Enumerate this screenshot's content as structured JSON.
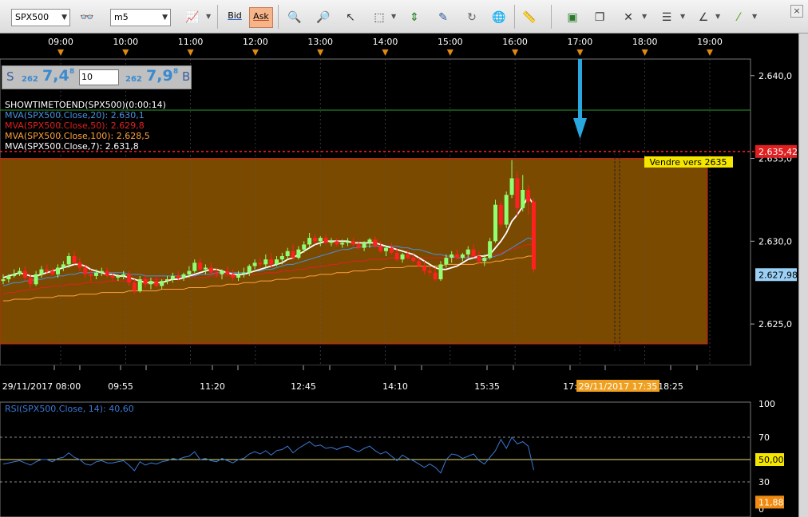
{
  "toolbar": {
    "symbol": "SPX500",
    "timeframe": "m5",
    "bid_label": "Bid",
    "ask_label": "Ask"
  },
  "quote": {
    "sell_letter": "S",
    "sell_small": "262",
    "sell_big": "7,4",
    "sell_sup": "8",
    "quantity": "10",
    "buy_small": "262",
    "buy_big": "7,9",
    "buy_sup": "8",
    "buy_letter": "B"
  },
  "indicators": [
    {
      "text": "SHOWTIMETOEND(SPX500)(0:00:14)",
      "color": "#ffffff"
    },
    {
      "text": "MVA(SPX500.Close,20): 2.630,1",
      "color": "#4a90e2"
    },
    {
      "text": "MVA(SPX500.Close,50): 2.629,8",
      "color": "#e02020"
    },
    {
      "text": "MVA(SPX500.Close,100): 2.628,5",
      "color": "#ffa040"
    },
    {
      "text": "MVA(SPX500.Close,7): 2.631,8",
      "color": "#ffffff"
    }
  ],
  "time_axis_top": [
    "09:00",
    "10:00",
    "11:00",
    "12:00",
    "13:00",
    "14:00",
    "15:00",
    "16:00",
    "17:00",
    "18:00",
    "19:00"
  ],
  "price_axis": {
    "ticks": [
      "2.640,0",
      "2.635,0",
      "2.630,0",
      "2.625,0"
    ],
    "alert_price": "2.635,42",
    "current_price": "2.627,98"
  },
  "annotation": "Vendre vers 2635",
  "time_axis_bottom": [
    "29/11/2017 08:00",
    "09:55",
    "11:20",
    "12:45",
    "14:10",
    "15:35",
    "17:",
    "18:25"
  ],
  "cursor_time": "29/11/2017 17:35",
  "rsi": {
    "label": "RSI(SPX500.Close, 14): 40,60",
    "ticks": [
      "100",
      "70",
      "50,00",
      "30",
      "0"
    ],
    "current": "11,88"
  },
  "colors": {
    "zone_fill": "#7a4a00",
    "bull_candle": "#90ff70",
    "bear_candle": "#ff2020",
    "rsi_line": "#3a7ad5",
    "alert_line": "#ff2020",
    "arrow": "#29a8e0"
  },
  "chart_data": {
    "type": "candlestick",
    "y_range": [
      2622.5,
      2641.0
    ],
    "candles": [
      [
        2627.6,
        2628.0,
        2627.4,
        2627.7
      ],
      [
        2627.7,
        2628.0,
        2627.5,
        2627.9
      ],
      [
        2627.9,
        2628.3,
        2627.8,
        2628.0
      ],
      [
        2628.0,
        2628.4,
        2627.9,
        2628.2
      ],
      [
        2628.2,
        2628.5,
        2627.6,
        2627.8
      ],
      [
        2627.8,
        2628.0,
        2627.2,
        2627.4
      ],
      [
        2627.4,
        2628.2,
        2627.3,
        2628.0
      ],
      [
        2628.0,
        2628.5,
        2627.8,
        2628.3
      ],
      [
        2628.3,
        2628.6,
        2628.0,
        2628.2
      ],
      [
        2628.2,
        2628.4,
        2627.9,
        2628.0
      ],
      [
        2628.0,
        2628.6,
        2627.8,
        2628.4
      ],
      [
        2628.4,
        2628.8,
        2628.2,
        2628.6
      ],
      [
        2628.6,
        2629.3,
        2628.4,
        2629.1
      ],
      [
        2629.1,
        2629.4,
        2628.6,
        2628.7
      ],
      [
        2628.7,
        2629.0,
        2628.2,
        2628.4
      ],
      [
        2628.4,
        2628.6,
        2627.8,
        2628.0
      ],
      [
        2628.0,
        2628.3,
        2627.6,
        2627.9
      ],
      [
        2627.9,
        2628.3,
        2627.7,
        2628.1
      ],
      [
        2628.1,
        2628.4,
        2627.9,
        2628.2
      ],
      [
        2628.2,
        2628.4,
        2627.8,
        2627.9
      ],
      [
        2627.9,
        2628.1,
        2627.6,
        2627.8
      ],
      [
        2627.8,
        2628.0,
        2627.6,
        2627.9
      ],
      [
        2627.9,
        2628.2,
        2627.7,
        2628.0
      ],
      [
        2628.0,
        2628.2,
        2627.3,
        2627.5
      ],
      [
        2627.5,
        2627.7,
        2626.8,
        2627.0
      ],
      [
        2627.0,
        2627.9,
        2626.9,
        2627.7
      ],
      [
        2627.7,
        2628.0,
        2627.2,
        2627.4
      ],
      [
        2627.4,
        2627.8,
        2627.1,
        2627.6
      ],
      [
        2627.6,
        2627.9,
        2627.2,
        2627.3
      ],
      [
        2627.3,
        2627.7,
        2627.1,
        2627.6
      ],
      [
        2627.6,
        2627.9,
        2627.4,
        2627.7
      ],
      [
        2627.7,
        2628.1,
        2627.5,
        2627.9
      ],
      [
        2627.9,
        2628.2,
        2627.6,
        2627.8
      ],
      [
        2627.8,
        2628.1,
        2627.6,
        2628.0
      ],
      [
        2628.0,
        2628.5,
        2627.8,
        2628.2
      ],
      [
        2628.2,
        2628.9,
        2628.1,
        2628.7
      ],
      [
        2628.7,
        2629.0,
        2628.2,
        2628.3
      ],
      [
        2628.3,
        2628.6,
        2628.0,
        2628.4
      ],
      [
        2628.4,
        2628.7,
        2628.0,
        2628.1
      ],
      [
        2628.1,
        2628.4,
        2627.8,
        2628.0
      ],
      [
        2628.0,
        2628.3,
        2627.7,
        2628.2
      ],
      [
        2628.2,
        2628.5,
        2627.9,
        2628.0
      ],
      [
        2628.0,
        2628.3,
        2627.6,
        2627.8
      ],
      [
        2627.8,
        2628.2,
        2627.6,
        2628.0
      ],
      [
        2628.0,
        2628.4,
        2627.8,
        2628.1
      ],
      [
        2628.1,
        2628.6,
        2627.9,
        2628.5
      ],
      [
        2628.5,
        2628.9,
        2628.3,
        2628.7
      ],
      [
        2628.7,
        2629.0,
        2628.4,
        2628.6
      ],
      [
        2628.6,
        2629.2,
        2628.4,
        2628.9
      ],
      [
        2628.9,
        2629.3,
        2628.4,
        2628.6
      ],
      [
        2628.6,
        2629.1,
        2628.5,
        2628.9
      ],
      [
        2628.9,
        2629.3,
        2628.6,
        2629.1
      ],
      [
        2629.1,
        2629.6,
        2628.9,
        2629.4
      ],
      [
        2629.4,
        2629.8,
        2628.9,
        2629.0
      ],
      [
        2629.0,
        2629.7,
        2628.9,
        2629.5
      ],
      [
        2629.5,
        2630.0,
        2629.3,
        2629.8
      ],
      [
        2629.8,
        2630.5,
        2629.6,
        2630.2
      ],
      [
        2630.2,
        2630.4,
        2629.8,
        2630.0
      ],
      [
        2630.0,
        2630.3,
        2629.7,
        2630.2
      ],
      [
        2630.2,
        2630.4,
        2629.8,
        2629.9
      ],
      [
        2629.9,
        2630.2,
        2629.7,
        2630.0
      ],
      [
        2630.0,
        2630.2,
        2629.7,
        2629.8
      ],
      [
        2629.8,
        2630.1,
        2629.6,
        2629.9
      ],
      [
        2629.9,
        2630.2,
        2629.7,
        2630.0
      ],
      [
        2630.0,
        2630.2,
        2629.7,
        2629.8
      ],
      [
        2629.8,
        2630.0,
        2629.5,
        2629.6
      ],
      [
        2629.6,
        2630.0,
        2629.4,
        2629.9
      ],
      [
        2629.9,
        2630.2,
        2629.6,
        2630.1
      ],
      [
        2630.1,
        2630.3,
        2629.6,
        2629.7
      ],
      [
        2629.7,
        2630.0,
        2629.3,
        2629.4
      ],
      [
        2629.4,
        2629.7,
        2629.1,
        2629.6
      ],
      [
        2629.6,
        2629.9,
        2629.2,
        2629.3
      ],
      [
        2629.3,
        2629.6,
        2628.8,
        2628.9
      ],
      [
        2628.9,
        2629.3,
        2628.7,
        2629.2
      ],
      [
        2629.2,
        2629.5,
        2628.9,
        2629.0
      ],
      [
        2629.0,
        2629.2,
        2628.7,
        2628.8
      ],
      [
        2628.8,
        2629.0,
        2628.4,
        2628.5
      ],
      [
        2628.5,
        2628.8,
        2628.0,
        2628.2
      ],
      [
        2628.2,
        2628.5,
        2627.9,
        2628.1
      ],
      [
        2628.1,
        2628.4,
        2627.6,
        2627.7
      ],
      [
        2627.7,
        2628.8,
        2627.6,
        2628.6
      ],
      [
        2628.6,
        2629.2,
        2628.4,
        2629.0
      ],
      [
        2629.0,
        2629.4,
        2628.7,
        2629.2
      ],
      [
        2629.2,
        2629.5,
        2628.9,
        2629.0
      ],
      [
        2629.0,
        2629.3,
        2628.8,
        2629.2
      ],
      [
        2629.2,
        2629.7,
        2629.0,
        2629.5
      ],
      [
        2629.5,
        2629.8,
        2629.0,
        2629.1
      ],
      [
        2629.1,
        2629.4,
        2628.6,
        2628.8
      ],
      [
        2628.8,
        2629.2,
        2628.5,
        2629.0
      ],
      [
        2629.0,
        2630.2,
        2628.9,
        2630.0
      ],
      [
        2630.0,
        2632.5,
        2629.9,
        2632.2
      ],
      [
        2632.2,
        2632.4,
        2630.8,
        2631.0
      ],
      [
        2631.0,
        2633.0,
        2630.8,
        2632.8
      ],
      [
        2632.8,
        2634.9,
        2632.6,
        2633.8
      ],
      [
        2633.8,
        2634.2,
        2631.5,
        2632.0
      ],
      [
        2632.0,
        2634.0,
        2631.8,
        2633.1
      ],
      [
        2633.1,
        2633.4,
        2631.6,
        2632.4
      ],
      [
        2632.4,
        2632.6,
        2628.1,
        2628.3
      ]
    ],
    "ma7": [
      2627.8,
      2627.9,
      2628.0,
      2628.1,
      2628.0,
      2627.9,
      2627.9,
      2628.0,
      2628.1,
      2628.2,
      2628.3,
      2628.4,
      2628.5,
      2628.6,
      2628.6,
      2628.5,
      2628.3,
      2628.2,
      2628.1,
      2628.0,
      2628.0,
      2627.9,
      2627.9,
      2627.8,
      2627.7,
      2627.6,
      2627.5,
      2627.5,
      2627.5,
      2627.5,
      2627.6,
      2627.7,
      2627.7,
      2627.8,
      2627.9,
      2628.0,
      2628.1,
      2628.2,
      2628.3,
      2628.3,
      2628.2,
      2628.1,
      2628.0,
      2628.0,
      2628.0,
      2628.1,
      2628.2,
      2628.3,
      2628.4,
      2628.5,
      2628.6,
      2628.7,
      2628.9,
      2629.0,
      2629.2,
      2629.4,
      2629.6,
      2629.8,
      2629.9,
      2630.0,
      2630.0,
      2630.0,
      2630.0,
      2630.0,
      2629.9,
      2629.9,
      2629.9,
      2629.9,
      2629.9,
      2629.8,
      2629.7,
      2629.6,
      2629.5,
      2629.4,
      2629.3,
      2629.2,
      2629.0,
      2628.8,
      2628.6,
      2628.4,
      2628.3,
      2628.3,
      2628.4,
      2628.5,
      2628.7,
      2628.9,
      2629.0,
      2629.1,
      2629.1,
      2629.2,
      2629.6,
      2630.0,
      2630.5,
      2631.2,
      2631.6,
      2632.1,
      2632.7,
      2632.2
    ],
    "ma20": [
      2627.3,
      2627.4,
      2627.5,
      2627.5,
      2627.6,
      2627.6,
      2627.7,
      2627.7,
      2627.8,
      2627.8,
      2627.9,
      2627.9,
      2628.0,
      2628.0,
      2628.1,
      2628.1,
      2628.1,
      2628.1,
      2628.1,
      2628.1,
      2628.1,
      2628.1,
      2628.1,
      2628.0,
      2628.0,
      2628.0,
      2627.9,
      2627.9,
      2627.9,
      2627.9,
      2627.9,
      2627.9,
      2627.9,
      2627.9,
      2627.9,
      2627.9,
      2628.0,
      2628.0,
      2628.0,
      2628.1,
      2628.1,
      2628.1,
      2628.1,
      2628.1,
      2628.1,
      2628.1,
      2628.2,
      2628.2,
      2628.3,
      2628.3,
      2628.4,
      2628.5,
      2628.6,
      2628.6,
      2628.7,
      2628.8,
      2628.9,
      2629.0,
      2629.1,
      2629.2,
      2629.3,
      2629.4,
      2629.5,
      2629.5,
      2629.6,
      2629.6,
      2629.7,
      2629.7,
      2629.7,
      2629.7,
      2629.7,
      2629.7,
      2629.7,
      2629.6,
      2629.6,
      2629.5,
      2629.5,
      2629.4,
      2629.3,
      2629.2,
      2629.2,
      2629.1,
      2629.1,
      2629.0,
      2629.0,
      2629.0,
      2629.0,
      2628.9,
      2628.9,
      2629.0,
      2629.1,
      2629.2,
      2629.4,
      2629.6,
      2629.8,
      2630.0,
      2630.2,
      2630.1
    ],
    "ma50": [
      2626.8,
      2626.9,
      2626.9,
      2627.0,
      2627.0,
      2627.1,
      2627.1,
      2627.2,
      2627.2,
      2627.3,
      2627.3,
      2627.3,
      2627.4,
      2627.4,
      2627.4,
      2627.5,
      2627.5,
      2627.5,
      2627.5,
      2627.6,
      2627.6,
      2627.6,
      2627.6,
      2627.6,
      2627.7,
      2627.7,
      2627.7,
      2627.7,
      2627.7,
      2627.7,
      2627.7,
      2627.7,
      2627.8,
      2627.8,
      2627.8,
      2627.8,
      2627.8,
      2627.8,
      2627.9,
      2627.9,
      2627.9,
      2627.9,
      2627.9,
      2627.9,
      2628.0,
      2628.0,
      2628.0,
      2628.0,
      2628.1,
      2628.1,
      2628.1,
      2628.2,
      2628.2,
      2628.2,
      2628.3,
      2628.3,
      2628.4,
      2628.4,
      2628.5,
      2628.5,
      2628.6,
      2628.6,
      2628.7,
      2628.7,
      2628.8,
      2628.8,
      2628.8,
      2628.9,
      2628.9,
      2628.9,
      2628.9,
      2629.0,
      2629.0,
      2629.0,
      2629.0,
      2629.0,
      2629.0,
      2629.0,
      2629.0,
      2629.0,
      2629.0,
      2629.0,
      2629.0,
      2629.0,
      2629.1,
      2629.1,
      2629.1,
      2629.1,
      2629.1,
      2629.2,
      2629.2,
      2629.3,
      2629.4,
      2629.5,
      2629.6,
      2629.7,
      2629.8,
      2629.8
    ],
    "ma100": [
      2626.4,
      2626.4,
      2626.5,
      2626.5,
      2626.5,
      2626.5,
      2626.6,
      2626.6,
      2626.6,
      2626.6,
      2626.7,
      2626.7,
      2626.7,
      2626.7,
      2626.8,
      2626.8,
      2626.8,
      2626.8,
      2626.9,
      2626.9,
      2626.9,
      2626.9,
      2626.9,
      2627.0,
      2627.0,
      2627.0,
      2627.0,
      2627.0,
      2627.0,
      2627.1,
      2627.1,
      2627.1,
      2627.1,
      2627.1,
      2627.2,
      2627.2,
      2627.2,
      2627.2,
      2627.3,
      2627.3,
      2627.3,
      2627.4,
      2627.4,
      2627.4,
      2627.5,
      2627.5,
      2627.5,
      2627.6,
      2627.6,
      2627.6,
      2627.7,
      2627.7,
      2627.7,
      2627.8,
      2627.8,
      2627.8,
      2627.9,
      2627.9,
      2628.0,
      2628.0,
      2628.0,
      2628.1,
      2628.1,
      2628.1,
      2628.2,
      2628.2,
      2628.2,
      2628.3,
      2628.3,
      2628.3,
      2628.4,
      2628.4,
      2628.4,
      2628.4,
      2628.5,
      2628.5,
      2628.5,
      2628.5,
      2628.5,
      2628.5,
      2628.5,
      2628.6,
      2628.6,
      2628.6,
      2628.6,
      2628.6,
      2628.6,
      2628.7,
      2628.7,
      2628.7,
      2628.8,
      2628.8,
      2628.9,
      2628.9,
      2629.0,
      2629.0,
      2629.1,
      2629.1
    ],
    "rsi": [
      46,
      47,
      48,
      49,
      47,
      45,
      48,
      50,
      50,
      48,
      51,
      52,
      56,
      52,
      50,
      46,
      45,
      48,
      49,
      47,
      47,
      48,
      49,
      45,
      40,
      48,
      45,
      47,
      46,
      48,
      49,
      51,
      50,
      52,
      53,
      57,
      50,
      51,
      49,
      48,
      51,
      49,
      47,
      50,
      51,
      55,
      57,
      55,
      58,
      54,
      58,
      59,
      62,
      56,
      60,
      63,
      66,
      62,
      63,
      60,
      61,
      59,
      61,
      62,
      59,
      57,
      60,
      62,
      58,
      55,
      57,
      53,
      49,
      54,
      51,
      49,
      46,
      43,
      46,
      43,
      38,
      50,
      55,
      54,
      51,
      53,
      55,
      49,
      46,
      52,
      58,
      68,
      60,
      70,
      64,
      66,
      62,
      40.6
    ],
    "zone": {
      "top": 2635.0,
      "bottom": 2623.8
    }
  }
}
